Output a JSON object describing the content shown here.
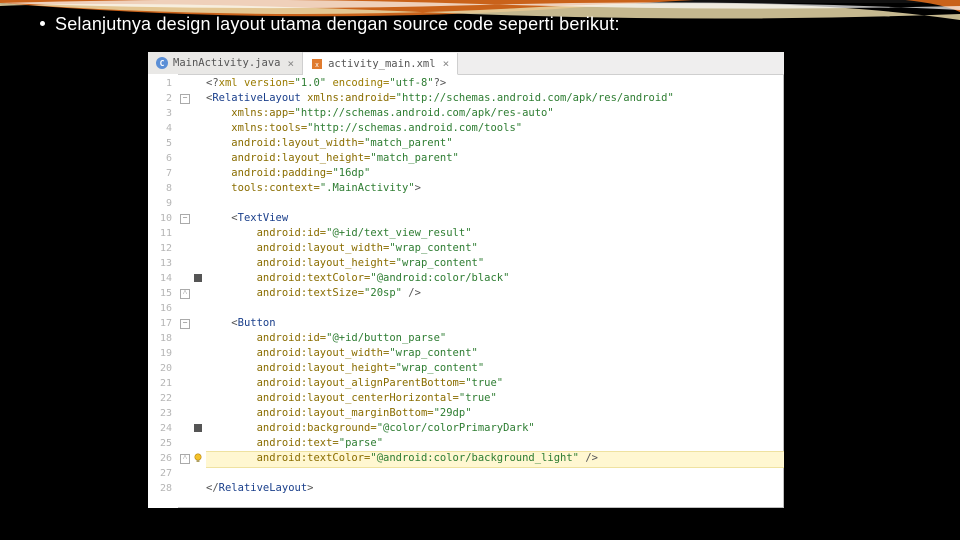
{
  "slide": {
    "bullet": "Selanjutnya design layout utama dengan source code seperti berikut:"
  },
  "tabs": [
    {
      "label": "MainActivity.java",
      "icon": "c-file",
      "active": false
    },
    {
      "label": "activity_main.xml",
      "icon": "xml-file",
      "active": true
    }
  ],
  "highlight_line": 26,
  "breakpoints": [
    14,
    24
  ],
  "bulb_line": 26,
  "fold_markers": [
    {
      "line": 2,
      "kind": "minus"
    },
    {
      "line": 10,
      "kind": "minus"
    },
    {
      "line": 15,
      "kind": "up"
    },
    {
      "line": 17,
      "kind": "minus"
    },
    {
      "line": 26,
      "kind": "up"
    }
  ],
  "code": [
    {
      "n": 1,
      "indent": 0,
      "tokens": [
        [
          "punc",
          "<?"
        ],
        [
          "pi",
          "xml version="
        ],
        [
          "str",
          "\"1.0\""
        ],
        [
          "pi",
          " encoding="
        ],
        [
          "str",
          "\"utf-8\""
        ],
        [
          "punc",
          "?>"
        ]
      ]
    },
    {
      "n": 2,
      "indent": 0,
      "tokens": [
        [
          "punc",
          "<"
        ],
        [
          "tag",
          "RelativeLayout "
        ],
        [
          "attr",
          "xmlns:android="
        ],
        [
          "str",
          "\"http://schemas.android.com/apk/res/android\""
        ]
      ]
    },
    {
      "n": 3,
      "indent": 1,
      "tokens": [
        [
          "attr",
          "xmlns:app="
        ],
        [
          "str",
          "\"http://schemas.android.com/apk/res-auto\""
        ]
      ]
    },
    {
      "n": 4,
      "indent": 1,
      "tokens": [
        [
          "attr",
          "xmlns:tools="
        ],
        [
          "str",
          "\"http://schemas.android.com/tools\""
        ]
      ]
    },
    {
      "n": 5,
      "indent": 1,
      "tokens": [
        [
          "attr",
          "android:layout_width="
        ],
        [
          "str",
          "\"match_parent\""
        ]
      ]
    },
    {
      "n": 6,
      "indent": 1,
      "tokens": [
        [
          "attr",
          "android:layout_height="
        ],
        [
          "str",
          "\"match_parent\""
        ]
      ]
    },
    {
      "n": 7,
      "indent": 1,
      "tokens": [
        [
          "attr",
          "android:padding="
        ],
        [
          "str",
          "\"16dp\""
        ]
      ]
    },
    {
      "n": 8,
      "indent": 1,
      "tokens": [
        [
          "attr",
          "tools:context="
        ],
        [
          "str",
          "\".MainActivity\""
        ],
        [
          "punc",
          ">"
        ]
      ]
    },
    {
      "n": 9,
      "indent": 0,
      "tokens": []
    },
    {
      "n": 10,
      "indent": 1,
      "tokens": [
        [
          "punc",
          "<"
        ],
        [
          "tag",
          "TextView"
        ]
      ]
    },
    {
      "n": 11,
      "indent": 2,
      "tokens": [
        [
          "attr",
          "android:id="
        ],
        [
          "str",
          "\"@+id/text_view_result\""
        ]
      ]
    },
    {
      "n": 12,
      "indent": 2,
      "tokens": [
        [
          "attr",
          "android:layout_width="
        ],
        [
          "str",
          "\"wrap_content\""
        ]
      ]
    },
    {
      "n": 13,
      "indent": 2,
      "tokens": [
        [
          "attr",
          "android:layout_height="
        ],
        [
          "str",
          "\"wrap_content\""
        ]
      ]
    },
    {
      "n": 14,
      "indent": 2,
      "tokens": [
        [
          "attr",
          "android:textColor="
        ],
        [
          "str",
          "\"@android:color/black\""
        ]
      ]
    },
    {
      "n": 15,
      "indent": 2,
      "tokens": [
        [
          "attr",
          "android:textSize="
        ],
        [
          "str",
          "\"20sp\""
        ],
        [
          "punc",
          " />"
        ]
      ]
    },
    {
      "n": 16,
      "indent": 0,
      "tokens": []
    },
    {
      "n": 17,
      "indent": 1,
      "tokens": [
        [
          "punc",
          "<"
        ],
        [
          "tag",
          "Button"
        ]
      ]
    },
    {
      "n": 18,
      "indent": 2,
      "tokens": [
        [
          "attr",
          "android:id="
        ],
        [
          "str",
          "\"@+id/button_parse\""
        ]
      ]
    },
    {
      "n": 19,
      "indent": 2,
      "tokens": [
        [
          "attr",
          "android:layout_width="
        ],
        [
          "str",
          "\"wrap_content\""
        ]
      ]
    },
    {
      "n": 20,
      "indent": 2,
      "tokens": [
        [
          "attr",
          "android:layout_height="
        ],
        [
          "str",
          "\"wrap_content\""
        ]
      ]
    },
    {
      "n": 21,
      "indent": 2,
      "tokens": [
        [
          "attr",
          "android:layout_alignParentBottom="
        ],
        [
          "str",
          "\"true\""
        ]
      ]
    },
    {
      "n": 22,
      "indent": 2,
      "tokens": [
        [
          "attr",
          "android:layout_centerHorizontal="
        ],
        [
          "str",
          "\"true\""
        ]
      ]
    },
    {
      "n": 23,
      "indent": 2,
      "tokens": [
        [
          "attr",
          "android:layout_marginBottom="
        ],
        [
          "str",
          "\"29dp\""
        ]
      ]
    },
    {
      "n": 24,
      "indent": 2,
      "tokens": [
        [
          "attr",
          "android:background="
        ],
        [
          "str",
          "\"@color/colorPrimaryDark\""
        ]
      ]
    },
    {
      "n": 25,
      "indent": 2,
      "tokens": [
        [
          "attr",
          "android:text="
        ],
        [
          "str",
          "\"parse\""
        ]
      ]
    },
    {
      "n": 26,
      "indent": 2,
      "tokens": [
        [
          "attr",
          "android:textColor="
        ],
        [
          "str",
          "\"@android:color/background_light\""
        ],
        [
          "punc",
          " />"
        ]
      ]
    },
    {
      "n": 27,
      "indent": 0,
      "tokens": []
    },
    {
      "n": 28,
      "indent": 0,
      "tokens": [
        [
          "punc",
          "</"
        ],
        [
          "tag",
          "RelativeLayout"
        ],
        [
          "punc",
          ">"
        ]
      ]
    }
  ]
}
